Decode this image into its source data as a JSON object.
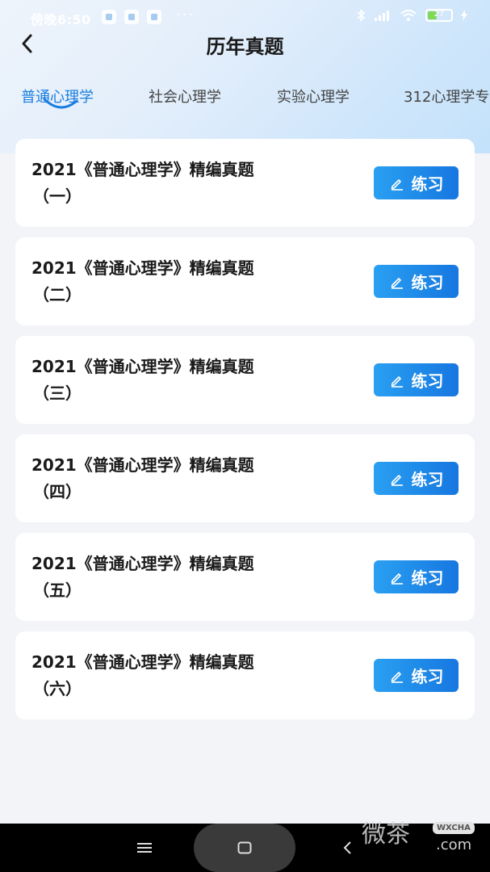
{
  "status_bar": {
    "time": "傍晚6:50",
    "dots": "···",
    "battery": "27"
  },
  "header": {
    "title": "历年真题"
  },
  "tabs": [
    {
      "label": "普通心理学",
      "active": true
    },
    {
      "label": "社会心理学",
      "active": false
    },
    {
      "label": "实验心理学",
      "active": false
    },
    {
      "label": "312心理学专",
      "active": false
    }
  ],
  "items": [
    {
      "title": "2021《普通心理学》精编真题",
      "sub": "（一）",
      "button": "练习"
    },
    {
      "title": "2021《普通心理学》精编真题",
      "sub": "（二）",
      "button": "练习"
    },
    {
      "title": "2021《普通心理学》精编真题",
      "sub": "（三）",
      "button": "练习"
    },
    {
      "title": "2021《普通心理学》精编真题",
      "sub": "（四）",
      "button": "练习"
    },
    {
      "title": "2021《普通心理学》精编真题",
      "sub": "（五）",
      "button": "练习"
    },
    {
      "title": "2021《普通心理学》精编真题",
      "sub": "（六）",
      "button": "练习"
    }
  ],
  "watermark": {
    "text": "微茶",
    "badge": "WXCHA",
    "domain": ".com"
  },
  "colors": {
    "accent": "#1a7ee0",
    "button_start": "#2aa0f2",
    "button_end": "#1677e0"
  }
}
